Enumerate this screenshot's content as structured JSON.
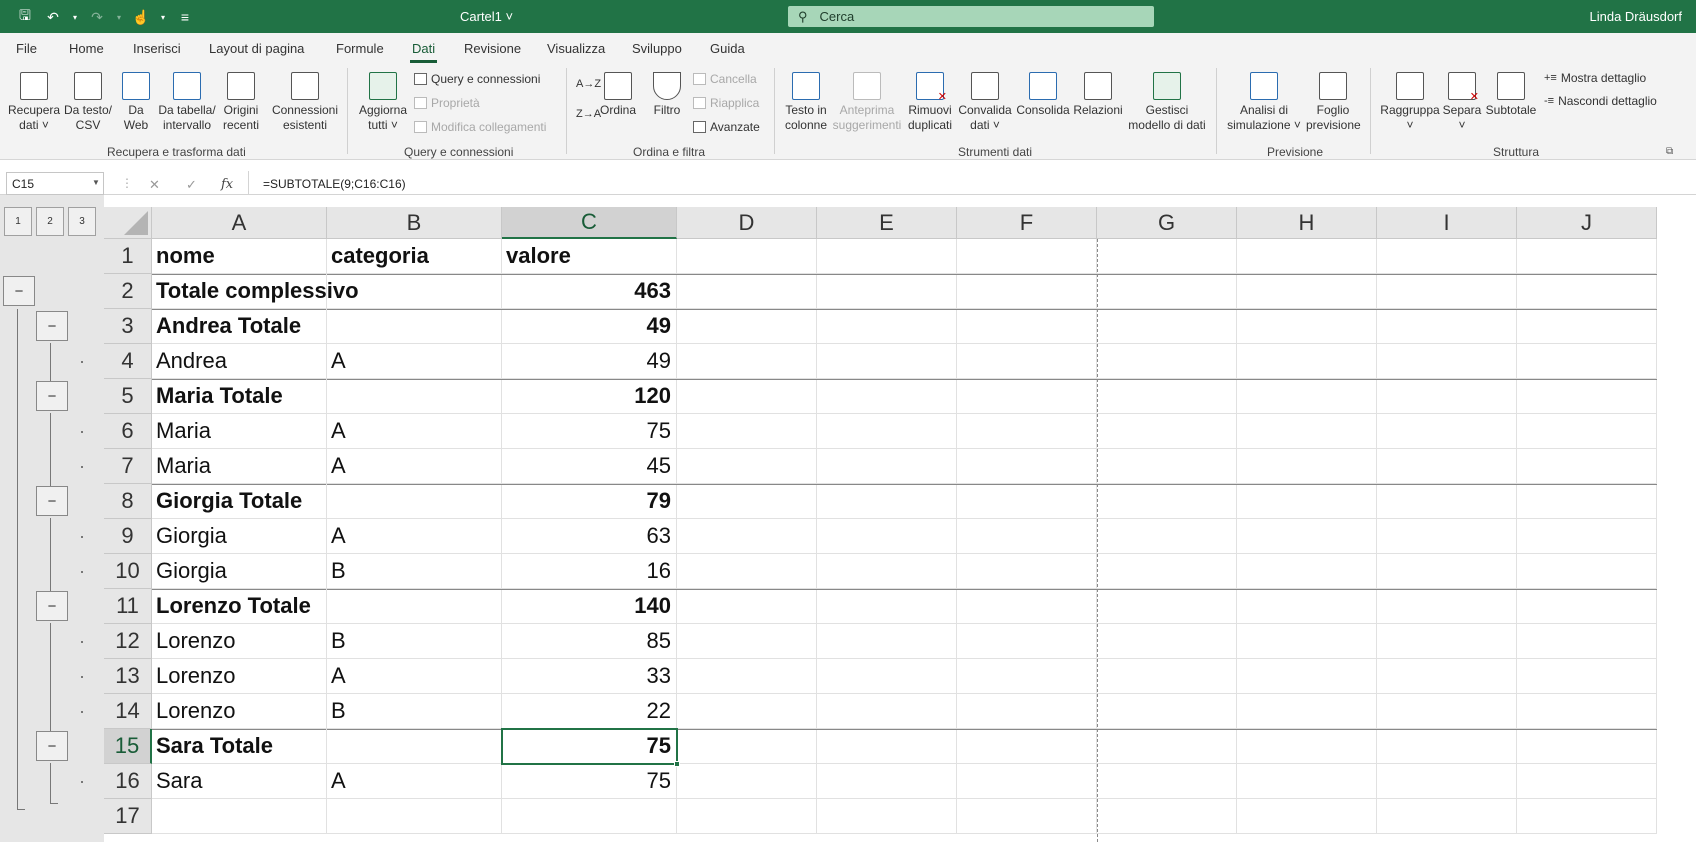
{
  "titlebar": {
    "doc_title": "Cartel1 ˅",
    "search_placeholder": "Cerca",
    "user": "Linda Dräusdorf"
  },
  "tabs": [
    "File",
    "Home",
    "Inserisci",
    "Layout di pagina",
    "Formule",
    "Dati",
    "Revisione",
    "Visualizza",
    "Sviluppo",
    "Guida"
  ],
  "active_tab": "Dati",
  "ribbon": {
    "recupera": [
      "Recupera",
      "dati ˅"
    ],
    "da_testo": [
      "Da testo/",
      "CSV"
    ],
    "da_web": [
      "Da",
      "Web"
    ],
    "da_tabella": [
      "Da tabella/",
      "intervallo"
    ],
    "origini": [
      "Origini",
      "recenti"
    ],
    "connessioni": [
      "Connessioni",
      "esistenti"
    ],
    "group1": "Recupera e trasforma dati",
    "aggiorna": [
      "Aggiorna",
      "tutti ˅"
    ],
    "query_conn": "Query e connessioni",
    "proprieta": "Proprietà",
    "modifica_coll": "Modifica collegamenti",
    "group2": "Query e connessioni",
    "sort_az": "A→Z",
    "sort_za": "Z→A",
    "ordina": "Ordina",
    "filtro": "Filtro",
    "cancella": "Cancella",
    "riapplica": "Riapplica",
    "avanzate": "Avanzate",
    "group3": "Ordina e filtra",
    "testo_colonne": [
      "Testo in",
      "colonne"
    ],
    "anteprima": [
      "Anteprima",
      "suggerimenti"
    ],
    "rimuovi": [
      "Rimuovi",
      "duplicati"
    ],
    "convalida": [
      "Convalida",
      "dati ˅"
    ],
    "consolida": "Consolida",
    "relazioni": "Relazioni",
    "gestisci": [
      "Gestisci",
      "modello di dati"
    ],
    "group4": "Strumenti dati",
    "analisi": [
      "Analisi di",
      "simulazione ˅"
    ],
    "foglio_prev": [
      "Foglio",
      "previsione"
    ],
    "group5": "Previsione",
    "raggruppa": [
      "Raggruppa",
      "˅"
    ],
    "separa": [
      "Separa",
      "˅"
    ],
    "subtotale": "Subtotale",
    "mostra": "Mostra dettaglio",
    "nascondi": "Nascondi dettaglio",
    "group6": "Struttura"
  },
  "formula_bar": {
    "name_box": "C15",
    "cancel": "✕",
    "confirm": "✓",
    "fx": "fx",
    "formula": "=SUBTOTALE(9;C16:C16)"
  },
  "outline_levels": [
    "1",
    "2",
    "3"
  ],
  "collapse_symbol": "−",
  "columns": [
    "A",
    "B",
    "C",
    "D",
    "E",
    "F",
    "G",
    "H",
    "I",
    "J"
  ],
  "rows": [
    {
      "n": "1",
      "a": "nome",
      "b": "categoria",
      "c": "valore",
      "bold": true
    },
    {
      "n": "2",
      "a": "Totale complessivo",
      "b": "",
      "c": "463",
      "bold": true
    },
    {
      "n": "3",
      "a": "Andrea Totale",
      "b": "",
      "c": "49",
      "bold": true
    },
    {
      "n": "4",
      "a": "Andrea",
      "b": "A",
      "c": "49",
      "bold": false
    },
    {
      "n": "5",
      "a": "Maria Totale",
      "b": "",
      "c": "120",
      "bold": true
    },
    {
      "n": "6",
      "a": "Maria",
      "b": "A",
      "c": "75",
      "bold": false
    },
    {
      "n": "7",
      "a": "Maria",
      "b": "A",
      "c": "45",
      "bold": false
    },
    {
      "n": "8",
      "a": "Giorgia Totale",
      "b": "",
      "c": "79",
      "bold": true
    },
    {
      "n": "9",
      "a": "Giorgia",
      "b": "A",
      "c": "63",
      "bold": false
    },
    {
      "n": "10",
      "a": "Giorgia",
      "b": "B",
      "c": "16",
      "bold": false
    },
    {
      "n": "11",
      "a": "Lorenzo Totale",
      "b": "",
      "c": "140",
      "bold": true
    },
    {
      "n": "12",
      "a": "Lorenzo",
      "b": "B",
      "c": "85",
      "bold": false
    },
    {
      "n": "13",
      "a": "Lorenzo",
      "b": "A",
      "c": "33",
      "bold": false
    },
    {
      "n": "14",
      "a": "Lorenzo",
      "b": "B",
      "c": "22",
      "bold": false
    },
    {
      "n": "15",
      "a": "Sara Totale",
      "b": "",
      "c": "75",
      "bold": true
    },
    {
      "n": "16",
      "a": "Sara",
      "b": "A",
      "c": "75",
      "bold": false
    },
    {
      "n": "17",
      "a": "",
      "b": "",
      "c": "",
      "bold": false
    }
  ],
  "selected_cell": "C15",
  "accent": "#217346"
}
